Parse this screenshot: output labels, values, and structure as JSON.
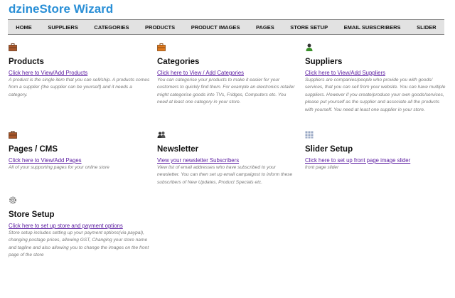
{
  "app": {
    "title": "dzineStore Wizard"
  },
  "nav": [
    {
      "label": "HOME"
    },
    {
      "label": "SUPPLIERS"
    },
    {
      "label": "CATEGORIES"
    },
    {
      "label": "PRODUCTS"
    },
    {
      "label": "PRODUCT IMAGES"
    },
    {
      "label": "PAGES"
    },
    {
      "label": "STORE SETUP"
    },
    {
      "label": "EMAIL SUBSCRIBERS"
    },
    {
      "label": "SLIDER"
    }
  ],
  "cards": {
    "products": {
      "icon": "briefcase-icon",
      "title": "Products",
      "link": "Click here to View/Add Products",
      "description": "A product is the single item that you can sell/ship. A products comes from a supplier (the supplier can be yourself) and it needs a category."
    },
    "categories": {
      "icon": "briefcase-icon",
      "title": "Categories",
      "link": "Click here to View / Add Categories",
      "description": "You can categorise your products to make it easier for your customers to quickly find them. For example an electronics retailer might categorise goods into TVs, Fridges, Computers etc. You need at least one category in your store."
    },
    "suppliers": {
      "icon": "user-icon",
      "title": "Suppliers",
      "link": "Click here to View/Add Suppliers",
      "description": "Suppliers are companies/people who provide you with goods/ services, that you can sell from your website. You can have multiple suppliers. However if you create/produce your own goods/services, please put yourself as the supplier and associate all the products with yourself. You need at least one supplier in your store."
    },
    "pages": {
      "icon": "briefcase-icon",
      "title": "Pages / CMS",
      "link": "Click here to View/Add Pages",
      "description": "All of your supporting pages for your online store"
    },
    "newsletter": {
      "icon": "users-icon",
      "title": "Newsletter",
      "link": "View your newsletter Subscribers",
      "description": "View list of email addresses who have subscribed to your newsletter. You can then set up email campaignst to inform these subscribers of New Updates, Product Specials etc."
    },
    "slider": {
      "icon": "grid-icon",
      "title": "Slider Setup",
      "link": "Click here to set up front page image slider",
      "description": "front page slider"
    },
    "store_setup": {
      "icon": "gear-icon",
      "title": "Store Setup",
      "link": "Click here to set up store and payment options",
      "description": "Store setup includes setting up your payment options(via paypal), changing postage prices, allowing GST, Changing your store name and tagline and also allowing you to change the images on the front page of the store"
    }
  },
  "colors": {
    "title": "#2a8fd6",
    "link": "#5a1aa0",
    "nav_bg": "#e2e2e2",
    "briefcase": "#a8562a",
    "briefcase_orange": "#e07a1e"
  }
}
